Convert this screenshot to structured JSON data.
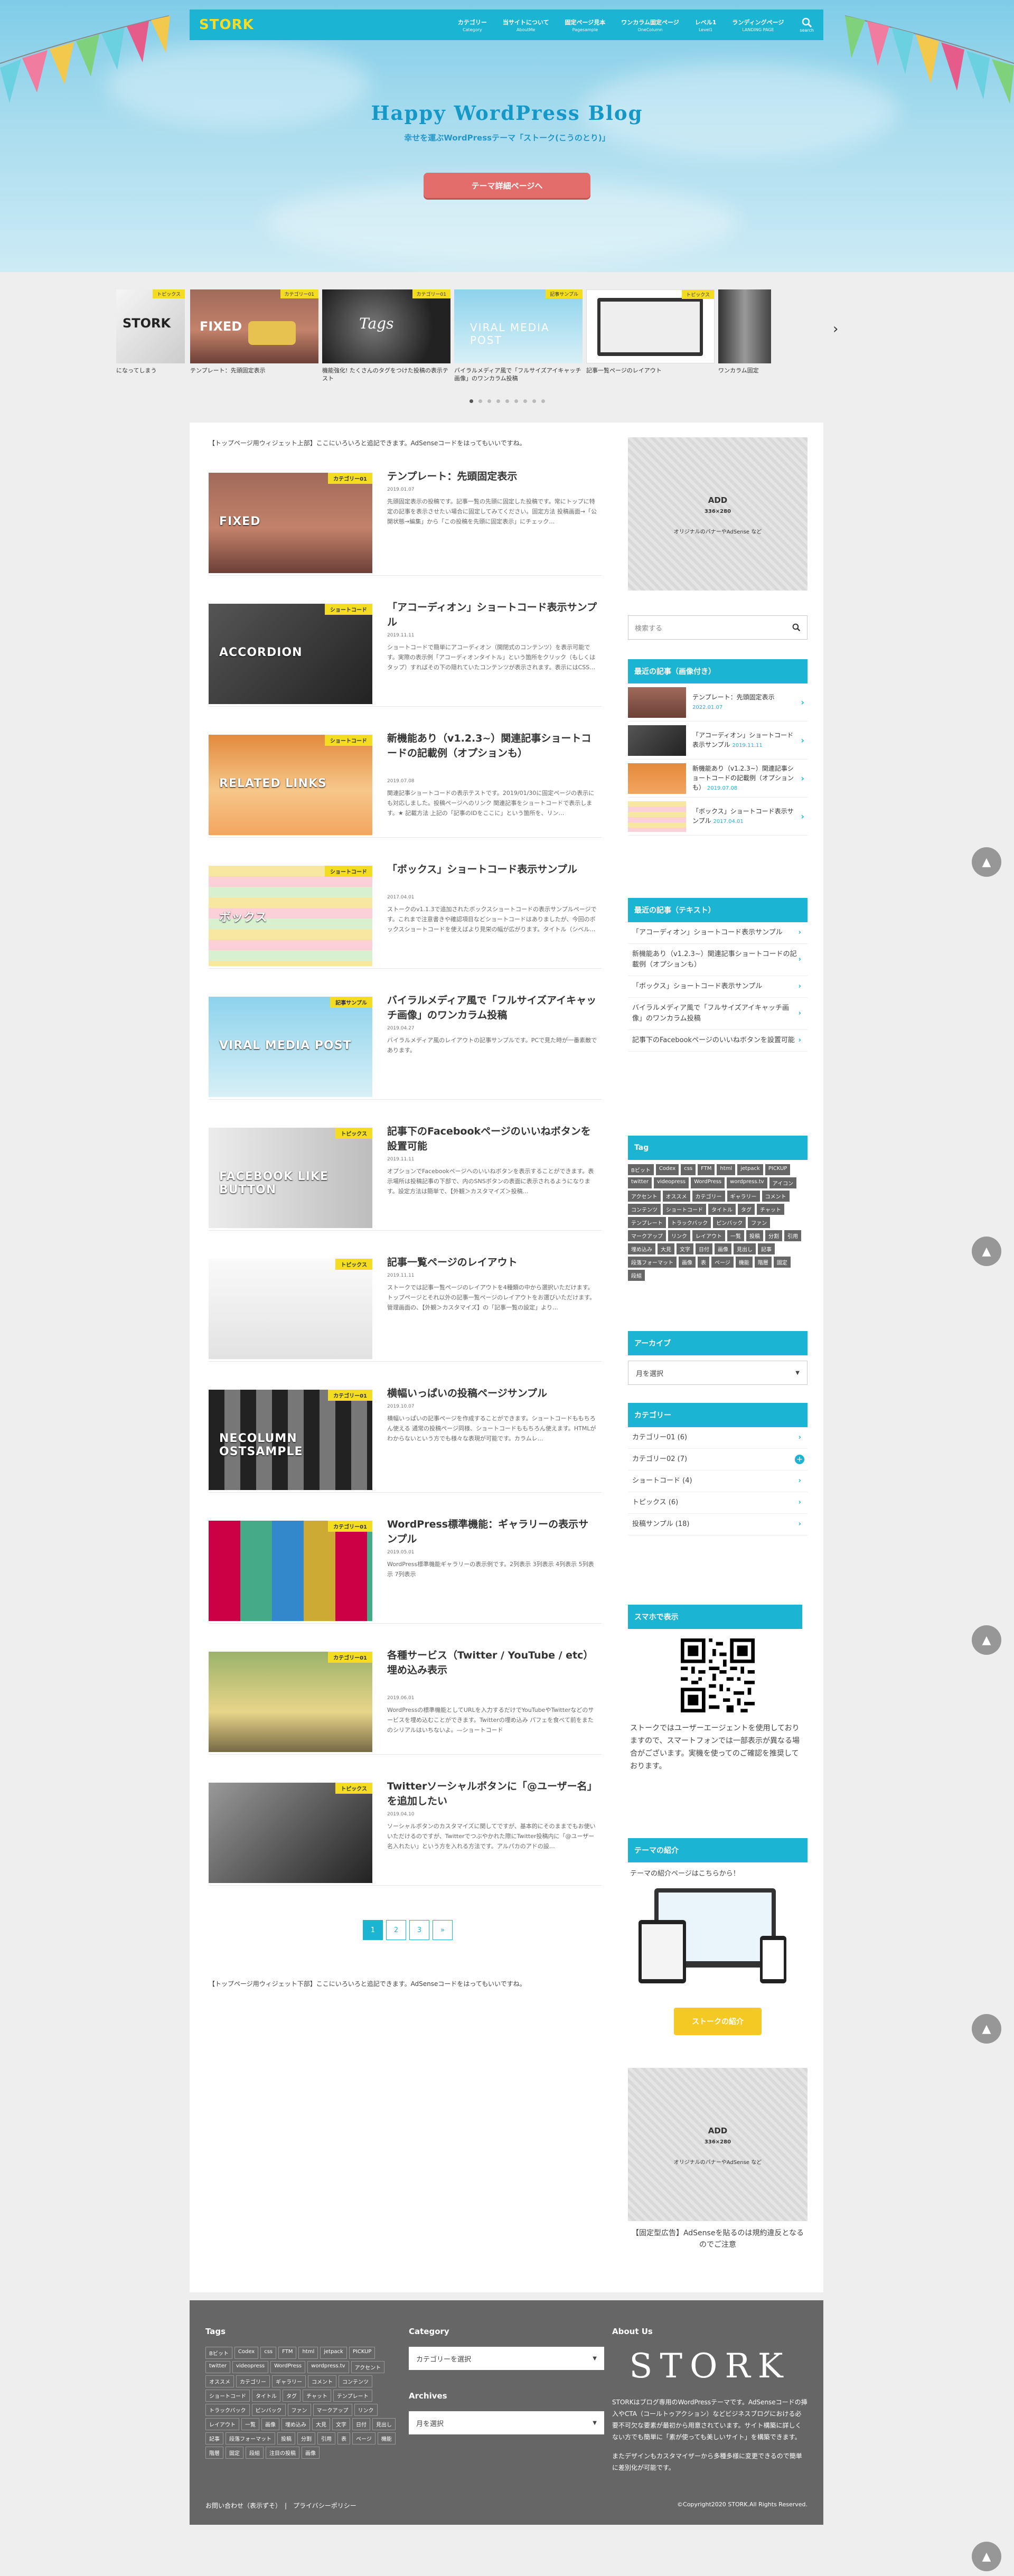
{
  "header": {
    "logo": "STORK",
    "nav": [
      {
        "t": "カテゴリー",
        "s": "Category"
      },
      {
        "t": "当サイトについて",
        "s": "AboutMe"
      },
      {
        "t": "固定ページ見本",
        "s": "Pagesample"
      },
      {
        "t": "ワンカラム固定ページ",
        "s": "OneColumn"
      },
      {
        "t": "レベル1",
        "s": "Level1"
      },
      {
        "t": "ランディングページ",
        "s": "LANDING PAGE"
      }
    ],
    "search": "search"
  },
  "hero": {
    "title": "Happy WordPress Blog",
    "subtitle": "幸せを運ぶWordPressテーマ「ストーク(こうのとり)」",
    "button": "テーマ詳細ページへ"
  },
  "slider": [
    {
      "cap": "になってしまう",
      "cat": "トピックス"
    },
    {
      "cap": "テンプレート：先頭固定表示",
      "cat": "カテゴリー01"
    },
    {
      "cap": "機能強化! たくさんのタグをつけた投稿の表示テスト",
      "cat": "カテゴリー01"
    },
    {
      "cap": "バイラルメディア風で「フルサイズアイキャッチ画像」のワンカラム投稿",
      "cat": "記事サンプル"
    },
    {
      "cap": "記事一覧ページのレイアウト",
      "cat": "トピックス"
    },
    {
      "cap": "ワンカラム固定",
      "cat": ""
    }
  ],
  "widget_top": "【トップページ用ウィジェット上部】ここにいろいろと追記できます。AdSenseコードをはってもいいですね。",
  "posts": [
    {
      "cat": "カテゴリー01",
      "title": "テンプレート：先頭固定表示",
      "date": "2019.01.07",
      "excerpt": "先頭固定表示の投稿です。記事一覧の先頭に固定した投稿です。常にトップに特定の記事を表示させたい場合に固定してみてください。固定方法 投稿画面→「公開状態→編集」から「この投稿を先頭に固定表示」にチェック…"
    },
    {
      "cat": "ショートコード",
      "title": "「アコーディオン」ショートコード表示サンプル",
      "date": "2019.11.11",
      "excerpt": "ショートコードで簡単にアコーディオン（開閉式のコンテンツ）を表示可能です。実際の表示例「アコーディオンタイトル」という箇所をクリック（もしくはタップ）すればその下の隠れていたコンテンツが表示されます。表示にはCSS…"
    },
    {
      "cat": "ショートコード",
      "title": "新機能あり（v1.2.3~）関連記事ショートコードの記載例（オプションも）",
      "date": "2019.07.08",
      "excerpt": "関連記事ショートコードの表示テストです。2019/01/30に固定ページの表示にも対応しました。投稿ページへのリンク 関連記事をショートコードで表示します。★ 記載方法 上記の「記事のIDをここに」という箇所を、リン…"
    },
    {
      "cat": "ショートコード",
      "title": "「ボックス」ショートコード表示サンプル",
      "date": "2017.04.01",
      "excerpt": "ストークのv1.1.3で追加されたボックスショートコードの表示サンプルページです。これまで注意書きや確認項目などショートコードはありましたが、今回のボックスショートコードを使えばより見栄の幅が広がります。タイトル（シベル…"
    },
    {
      "cat": "記事サンプル",
      "title": "バイラルメディア風で「フルサイズアイキャッチ画像」のワンカラム投稿",
      "date": "2019.04.27",
      "excerpt": "バイラルメディア風のレイアウトの記事サンプルです。PCで見た時が一番素敵であります。"
    },
    {
      "cat": "トピックス",
      "title": "記事下のFacebookページのいいねボタンを設置可能",
      "date": "2019.11.11",
      "excerpt": "オプションでFacebookページへのいいねボタンを表示することができます。表示場所は投稿記事の下部で、内のSNSボタンの表面に表示されるようになります。設定方法は簡単で、【外観＞カスタマイズ＞投稿…"
    },
    {
      "cat": "トピックス",
      "title": "記事一覧ページのレイアウト",
      "date": "2019.11.11",
      "excerpt": "ストークでは記事一覧ページのレイアウトを4種類の中から選択いただけます。トップページとそれ以外の記事一覧ページのレイアウトをお選びいただけます。管理画面の、【外観＞カスタマイズ】の「記事一覧の設定」より…"
    },
    {
      "cat": "カテゴリー01",
      "title": "横幅いっぱいの投稿ページサンプル",
      "date": "2019.10.07",
      "excerpt": "横幅いっぱいの記事ページを作成することができます。ショートコードももちろん使える 通常の投稿ページ同様、ショートコードももちろん使えます。HTMLがわからないという方でも様々な表現が可能です。カラムレ…"
    },
    {
      "cat": "カテゴリー01",
      "title": "WordPress標準機能：ギャラリーの表示サンプル",
      "date": "2019.05.01",
      "excerpt": "WordPress標準機能ギャラリーの表示例です。2列表示 3列表示 4列表示 5列表示 7列表示"
    },
    {
      "cat": "カテゴリー01",
      "title": "各種サービス（Twitter / YouTube / etc）埋め込み表示",
      "date": "2019.06.01",
      "excerpt": "WordPressの標準機能としてURLを入力するだけでYouTubeやTwitterなどのサービスを埋め込むことができます。Twitterの埋め込み パフェを食べて前をまたのシリアルはいちないよ。—ショートコード"
    },
    {
      "cat": "トピックス",
      "title": "Twitterソーシャルボタンに「@ユーザー名」を追加したい",
      "date": "2019.04.10",
      "excerpt": "ソーシャルボタンのカスタマイズに関してですが、基本的にそのままでもお使いいただけるのですが、Twitterでつぶやかれた際にTwitter投稿内に「@ユーザー名入れたい」という方を入れる方法です。アルパカのアドの設…"
    }
  ],
  "pager": [
    "1",
    "2",
    "3",
    "»"
  ],
  "widget_bottom": "【トップページ用ウィジェット下部】ここにいろいろと追記できます。AdSenseコードをはってもいいですね。",
  "sidebar": {
    "ad_top": {
      "title": "ADD",
      "size": "336×280",
      "desc": "オリジナルのバナーやAdSense など"
    },
    "search_placeholder": "検索する",
    "recent_title": "最近の記事（画像付き）",
    "recent": [
      {
        "t": "テンプレート：先頭固定表示",
        "d": "2022.01.07"
      },
      {
        "t": "「アコーディオン」ショートコード表示サンプル",
        "d": "2019.11.11"
      },
      {
        "t": "新機能あり（v1.2.3~）関連記事ショートコードの記載例（オプションも）",
        "d": "2019.07.08"
      },
      {
        "t": "「ボックス」ショートコード表示サンプル",
        "d": "2017.04.01"
      }
    ],
    "recent_text_title": "最近の記事（テキスト）",
    "recent_text": [
      "「アコーディオン」ショートコード表示サンプル",
      "新機能あり（v1.2.3~）関連記事ショートコードの記載例（オプションも）",
      "「ボックス」ショートコード表示サンプル",
      "バイラルメディア風で「フルサイズアイキャッチ画像」のワンカラム投稿",
      "記事下のFacebookページのいいねボタンを設置可能"
    ],
    "tag_title": "Tag",
    "tags": [
      "Bビット",
      "Codex",
      "css",
      "FTM",
      "html",
      "jetpack",
      "PICKUP",
      "twitter",
      "videopress",
      "WordPress",
      "wordpress.tv",
      "アイコン",
      "アクセント",
      "オススメ",
      "カテゴリー",
      "ギャラリー",
      "コメント",
      "コンテンツ",
      "ショートコード",
      "タイトル",
      "タグ",
      "チャット",
      "テンプレート",
      "トラックバック",
      "ピンバック",
      "ファン",
      "マークアップ",
      "リンク",
      "レイアウト",
      "一覧",
      "投稿",
      "分割",
      "引用",
      "埋め込み",
      "大見",
      "文字",
      "日付",
      "画像",
      "見出し",
      "記事",
      "段落フォーマット",
      "画像",
      "表",
      "ページ",
      "機能",
      "階層",
      "固定",
      "段組"
    ],
    "archive_title": "アーカイブ",
    "archive_select": "月を選択",
    "category_title": "カテゴリー",
    "categories": [
      "カテゴリー01 (6)",
      "カテゴリー02 (7)",
      "ショートコード (4)",
      "トピックス (6)",
      "投稿サンプル (18)"
    ],
    "mobile_title": "スマホで表示",
    "mobile_text": "ストークではユーザーエージェントを使用しておりますので、スマートフォンでは一部表示が異なる場合がございます。実機を使ってのご確認を推奨しております。",
    "theme_title": "テーマの紹介",
    "theme_text": "テーマの紹介ページはこちらから！",
    "theme_button": "ストークの紹介",
    "ad_bottom": {
      "title": "ADD",
      "size": "336×280",
      "desc": "オリジナルのバナーやAdSense など"
    },
    "ad_note": "【固定型広告】AdSenseを貼るのは規約違反となるのでご注意"
  },
  "footer": {
    "tags_title": "Tags",
    "tags": [
      "Bビット",
      "Codex",
      "css",
      "FTM",
      "html",
      "jetpack",
      "PICKUP",
      "twitter",
      "videopress",
      "WordPress",
      "wordpress.tv",
      "アクセント",
      "オススメ",
      "カテゴリー",
      "ギャラリー",
      "コメント",
      "コンテンツ",
      "ショートコード",
      "タイトル",
      "タグ",
      "チャット",
      "テンプレート",
      "トラックバック",
      "ピンバック",
      "ファン",
      "マークアップ",
      "リンク",
      "レイアウト",
      "一覧",
      "画像",
      "埋め込み",
      "大見",
      "文字",
      "日付",
      "見出し",
      "記事",
      "段落フォーマット",
      "投稿",
      "分割",
      "引用",
      "表",
      "ページ",
      "機能",
      "階層",
      "固定",
      "段組",
      "注目の投稿",
      "画像"
    ],
    "category_title": "Category",
    "category_select": "カテゴリーを選択",
    "archives_title": "Archives",
    "archives_select": "月を選択",
    "about_title": "About Us",
    "about_logo": "STORK",
    "about_text": "STORKはブログ専用のWordPressテーマです。AdSenseコードの挿入やCTA（コールトゥアクション）などビジネスブログにおける必要不可欠な要素が最初から用意されています。サイト構築に詳しくない方でも簡単に「素が使っても美しいサイト」を構築できます。",
    "about_text2": "またデザインもカスタマイザーから多種多様に変更できるので簡単に差別化が可能です。",
    "links": "お問い合わせ（表示ずそ）　|　プライバシーポリシー",
    "copy": "©Copyright2020 STORK.All Rights Reserved."
  },
  "scroll_top": "▲"
}
